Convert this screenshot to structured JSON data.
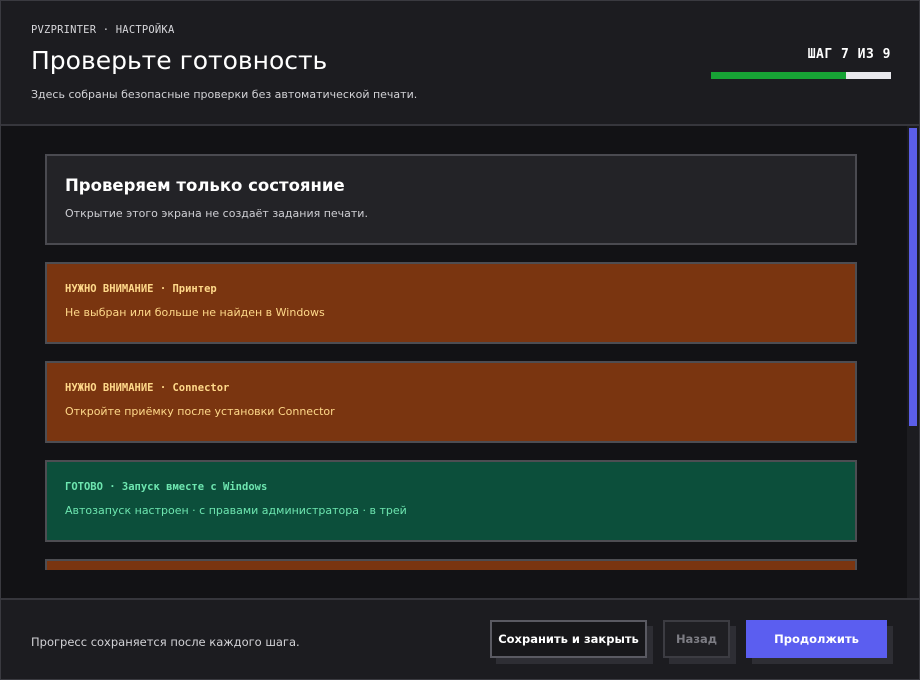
{
  "header": {
    "breadcrumb": "PVZPRINTER · НАСТРОЙКА",
    "title": "Проверьте готовность",
    "subtitle": "Здесь собраны безопасные проверки без автоматической печати.",
    "step_label": "ШАГ 7 ИЗ 9",
    "progress_fraction": 0.75,
    "progress_color": "#17a335"
  },
  "info_card": {
    "title": "Проверяем только состояние",
    "description": "Открытие этого экрана не создаёт задания печати."
  },
  "checks": [
    {
      "status": "warn",
      "heading": "НУЖНО ВНИМАНИЕ · Принтер",
      "description": "Не выбран или больше не найден в Windows"
    },
    {
      "status": "warn",
      "heading": "НУЖНО ВНИМАНИЕ · Connector",
      "description": "Откройте приёмку после установки Connector"
    },
    {
      "status": "ok",
      "heading": "ГОТОВО · Запуск вместе с Windows",
      "description": "Автозапуск настроен · с правами администратора · в трей"
    },
    {
      "status": "warn",
      "heading": "",
      "description": ""
    }
  ],
  "footer": {
    "note": "Прогресс сохраняется после каждого шага.",
    "save_label": "Сохранить и закрыть",
    "back_label": "Назад",
    "next_label": "Продолжить"
  },
  "colors": {
    "accent": "#5b5ef0",
    "warn_bg": "#7a3510",
    "warn_text": "#ffd98a",
    "ok_bg": "#0c4f3b",
    "ok_text": "#6ee6b0"
  }
}
